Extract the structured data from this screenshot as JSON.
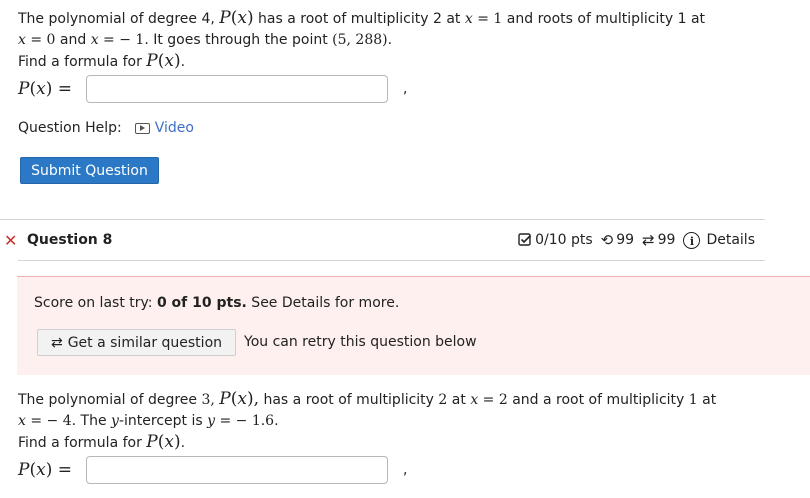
{
  "question7": {
    "line1": {
      "a": "The polynomial of degree 4, ",
      "m1a": "P",
      "m1b": "(",
      "m1c": "x",
      "m1d": ")",
      "b": " has a root of multiplicity 2 at ",
      "m2a": "x",
      "m2b": " = 1",
      "c": " and roots of multiplicity 1 at"
    },
    "line2": {
      "m1a": "x",
      "m1b": " = 0",
      "a": " and ",
      "m2a": "x",
      "m2b": " =  − 1.",
      "b": " It goes through the point ",
      "m3": "(5, 288).",
      "c": ""
    },
    "line3": {
      "a": "Find a formula for ",
      "m1a": "P",
      "m1b": "(",
      "m1c": "x",
      "m1d": ")",
      "b": "."
    },
    "answer": {
      "label_p": "P",
      "label_open": "(",
      "label_x": "x",
      "label_close": ") =",
      "value": "",
      "comma": ","
    }
  },
  "help": {
    "label": "Question Help:",
    "video_label": "Video"
  },
  "submit_label": "Submit Question",
  "question8": {
    "close_symbol": "✕",
    "title": "Question 8",
    "points": "0/10 pts",
    "retries": "99",
    "attempts": "99",
    "details_label": "Details",
    "score": {
      "prefix": "Score on last try: ",
      "bold": "0 of 10 pts.",
      "suffix": " See Details for more."
    },
    "similar_label": "Get a similar question",
    "retry_text": "You can retry this question below",
    "line1": {
      "a": "The polynomial of degree ",
      "m1": "3, ",
      "m2a": "P",
      "m2b": "(",
      "m2c": "x",
      "m2d": "),",
      "b": " has a root of multiplicity ",
      "m3": "2",
      "c": " at ",
      "m4a": "x",
      "m4b": " = 2",
      "d": " and a root of multiplicity ",
      "m5": "1",
      "e": " at"
    },
    "line2": {
      "m1a": "x",
      "m1b": " =  − 4.",
      "a": " The ",
      "m2": "y",
      "b": "-intercept is ",
      "m3a": "y",
      "m3b": " =  − 1.6.",
      "c": ""
    },
    "line3": {
      "a": "Find a formula for ",
      "m1a": "P",
      "m1b": "(",
      "m1c": "x",
      "m1d": ")",
      "b": "."
    },
    "answer": {
      "label_p": "P",
      "label_open": "(",
      "label_x": "x",
      "label_close": ") =",
      "value": "",
      "comma": ","
    }
  },
  "colors": {
    "submit_bg": "#2b79c6",
    "link": "#3d6fc4",
    "error_x": "#c9302c",
    "score_bg": "#fdf0ef"
  },
  "icons": [
    "video-icon",
    "checkbox-icon",
    "undo-icon",
    "retry-icon",
    "info-icon",
    "close-icon"
  ]
}
